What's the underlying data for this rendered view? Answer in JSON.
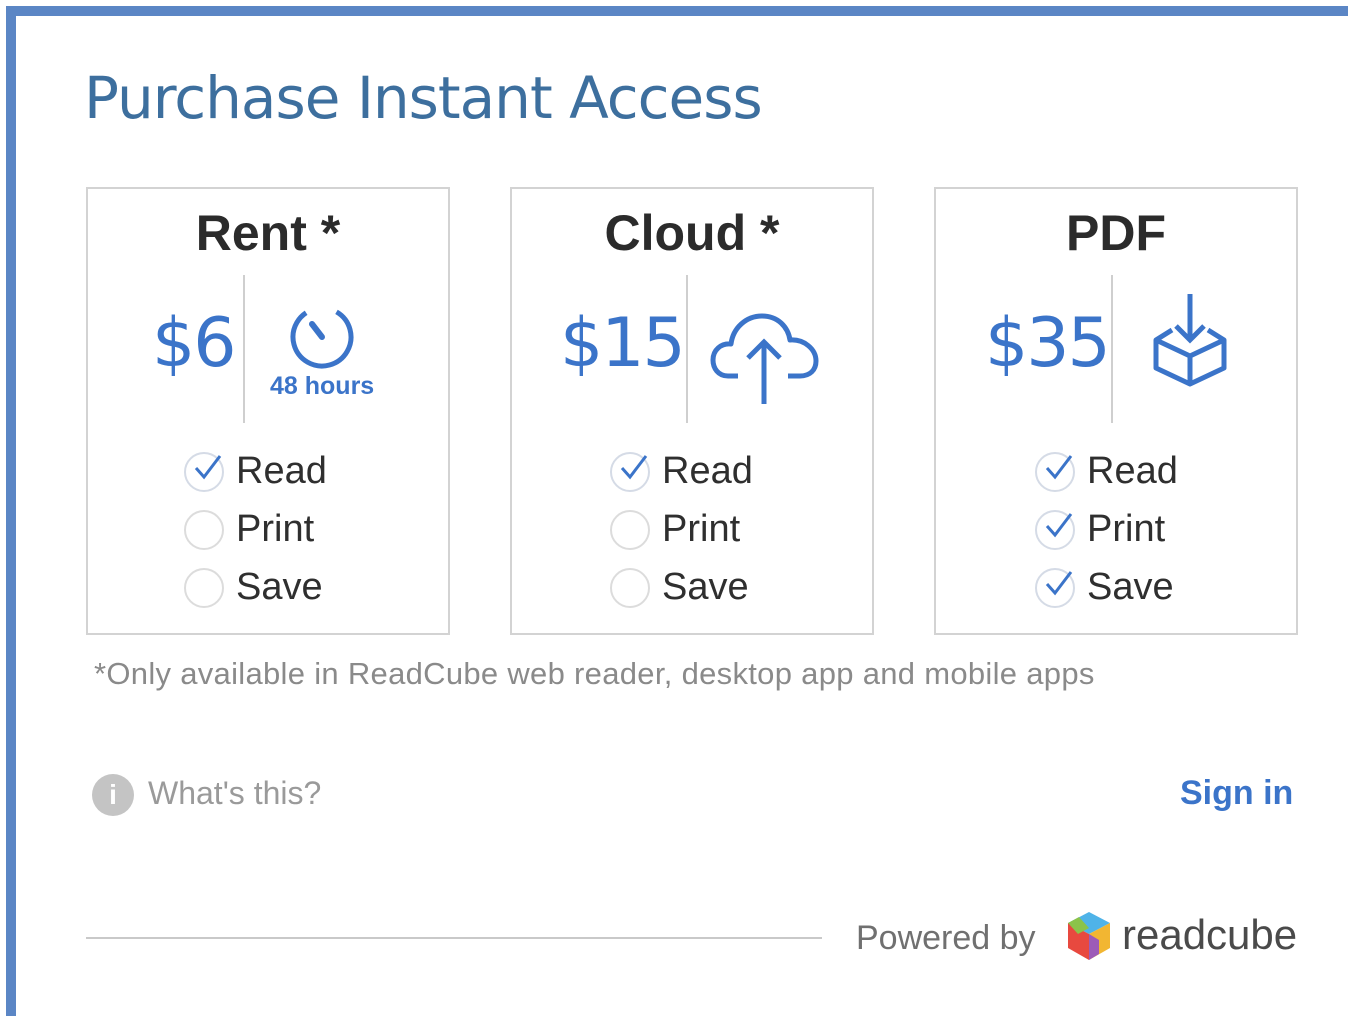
{
  "title": "Purchase Instant Access",
  "options": [
    {
      "name": "Rent *",
      "price": "$6",
      "icon": "timer-icon",
      "duration": "48 hours",
      "features": [
        {
          "label": "Read",
          "checked": true
        },
        {
          "label": "Print",
          "checked": false
        },
        {
          "label": "Save",
          "checked": false
        }
      ]
    },
    {
      "name": "Cloud *",
      "price": "$15",
      "icon": "cloud-upload-icon",
      "features": [
        {
          "label": "Read",
          "checked": true
        },
        {
          "label": "Print",
          "checked": false
        },
        {
          "label": "Save",
          "checked": false
        }
      ]
    },
    {
      "name": "PDF",
      "price": "$35",
      "icon": "download-box-icon",
      "features": [
        {
          "label": "Read",
          "checked": true
        },
        {
          "label": "Print",
          "checked": true
        },
        {
          "label": "Save",
          "checked": true
        }
      ]
    }
  ],
  "footnote": "*Only available in ReadCube web reader, desktop app and mobile apps",
  "help": {
    "icon": "info-icon",
    "glyph": "i",
    "label": "What's this?"
  },
  "signin_label": "Sign in",
  "footer": {
    "powered_by": "Powered by",
    "brand": "readcube",
    "logo_icon": "readcube-logo-icon"
  },
  "colors": {
    "accent": "#3b74c9",
    "border": "#5b86c5",
    "title": "#3d6f9e"
  }
}
